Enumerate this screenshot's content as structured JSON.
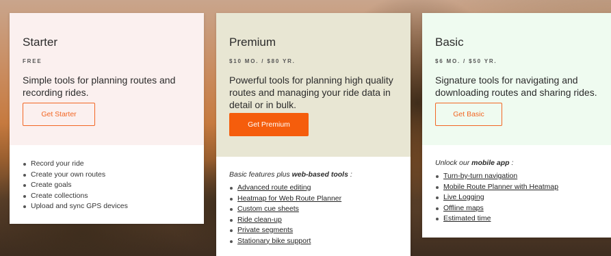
{
  "plans": [
    {
      "name": "Starter",
      "price": "FREE",
      "description": "Simple tools for planning routes and recording rides.",
      "button": "Get Starter",
      "intro_prefix": "",
      "intro_bold": "",
      "intro_suffix": "",
      "features": [
        "Record your ride",
        "Create your own routes",
        "Create goals",
        "Create collections",
        "Upload and sync GPS devices"
      ]
    },
    {
      "name": "Premium",
      "price": "$10 MO. / $80 YR.",
      "description": "Powerful tools for planning high quality routes and managing your ride data in detail or in bulk.",
      "button": "Get Premium",
      "intro_prefix": "Basic features plus ",
      "intro_bold": "web-based tools",
      "intro_suffix": " :",
      "features": [
        "Advanced route editing",
        "Heatmap for Web Route Planner",
        "Custom cue sheets",
        "Ride clean-up",
        "Private segments",
        "Stationary bike support"
      ]
    },
    {
      "name": "Basic",
      "price": "$6 MO. / $50 YR.",
      "description": "Signature tools for navigating and downloading routes and sharing rides.",
      "button": "Get Basic",
      "intro_prefix": "Unlock our ",
      "intro_bold": "mobile app",
      "intro_suffix": " :",
      "features": [
        "Turn-by-turn navigation",
        "Mobile Route Planner with Heatmap",
        "Live Logging",
        "Offline maps",
        "Estimated time"
      ]
    }
  ],
  "colors": {
    "accent": "#f26522",
    "starter_bg": "#fbf0ef",
    "premium_bg": "#e8e6d3",
    "basic_bg": "#effbf0"
  }
}
